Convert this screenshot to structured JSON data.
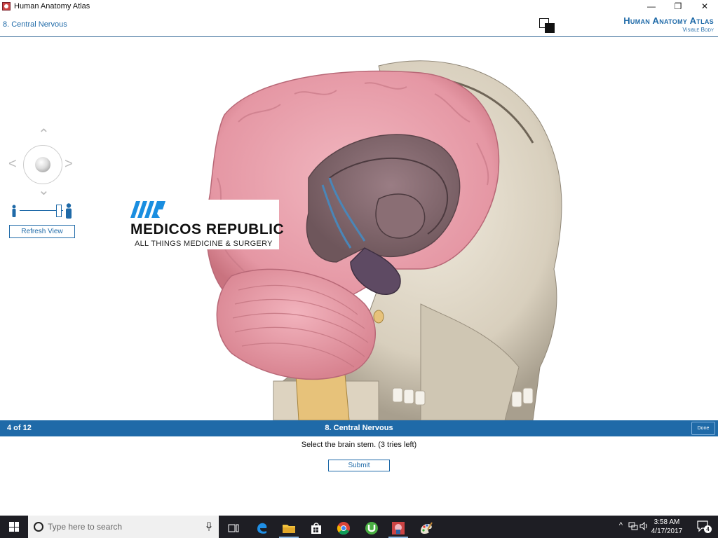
{
  "window": {
    "title": "Human Anatomy Atlas",
    "minimize": "—",
    "restore": "❐",
    "close": "✕"
  },
  "header": {
    "chapter": "8. Central Nervous",
    "brand_title": "Human Anatomy Atlas",
    "brand_sub": "Visible Body"
  },
  "navigation": {
    "up": "⌃",
    "down": "⌄",
    "left": "<",
    "right": ">",
    "refresh_label": "Refresh View"
  },
  "watermark": {
    "logo": "MR",
    "title": "MEDICOS REPUBLIC",
    "subtitle": "ALL THINGS MEDICINE & SURGERY"
  },
  "quiz": {
    "progress": "4 of 12",
    "title": "8. Central Nervous",
    "done_label": "Done",
    "question": "Select the brain stem. (3 tries left)",
    "submit_label": "Submit"
  },
  "taskbar": {
    "search_placeholder": "Type here to search",
    "apps": [
      "task-view",
      "edge",
      "file-explorer",
      "store",
      "chrome",
      "utorrent",
      "anatomy-atlas",
      "paint"
    ],
    "time": "3:58 AM",
    "date": "4/17/2017",
    "notification_count": "4",
    "accent": "#1f6aa8"
  }
}
